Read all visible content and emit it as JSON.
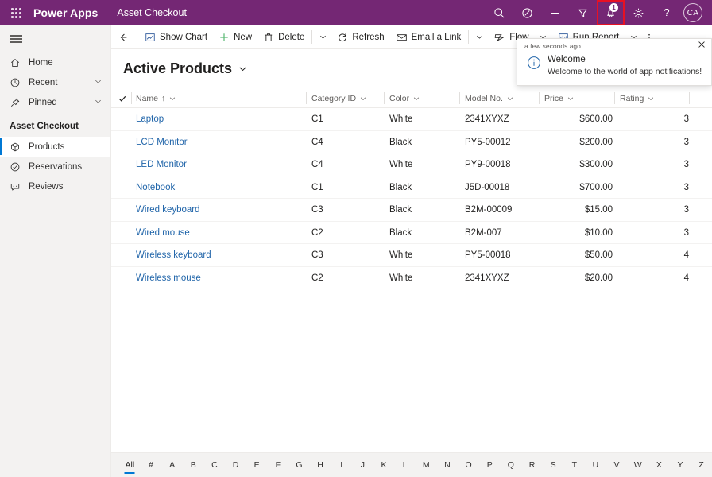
{
  "topbar": {
    "waffle_label": "app-launcher",
    "brand": "Power Apps",
    "app_name": "Asset Checkout",
    "icons": [
      "search-icon",
      "diagnostics-icon",
      "plus-icon",
      "filter-icon",
      "notification-bell-icon",
      "settings-gear-icon",
      "help-icon"
    ],
    "notification_count": "1",
    "avatar_initials": "CA",
    "background_color": "#742774",
    "highlight_color": "#e81123"
  },
  "sidebar": {
    "items": [
      {
        "label": "Home",
        "icon": "home-icon",
        "chevron": false
      },
      {
        "label": "Recent",
        "icon": "clock-icon",
        "chevron": true
      },
      {
        "label": "Pinned",
        "icon": "pin-icon",
        "chevron": true
      }
    ],
    "group_title": "Asset Checkout",
    "group_items": [
      {
        "label": "Products",
        "icon": "box-icon",
        "selected": true
      },
      {
        "label": "Reservations",
        "icon": "check-circle-icon",
        "selected": false
      },
      {
        "label": "Reviews",
        "icon": "comment-icon",
        "selected": false
      }
    ],
    "selected_accent": "#0078d4"
  },
  "commandbar": {
    "back_label": "back-arrow",
    "buttons": [
      {
        "label": "Show Chart",
        "icon": "chart-icon"
      },
      {
        "label": "New",
        "icon": "plus-icon"
      },
      {
        "label": "Delete",
        "icon": "trash-icon"
      },
      {
        "label": "Refresh",
        "icon": "refresh-icon"
      },
      {
        "label": "Email a Link",
        "icon": "email-icon"
      },
      {
        "label": "Flow",
        "icon": "flow-icon"
      },
      {
        "label": "Run Report",
        "icon": "report-icon"
      }
    ]
  },
  "notification": {
    "time": "a few seconds ago",
    "title": "Welcome",
    "message": "Welcome to the world of app notifications!",
    "close_label": "close",
    "icon": "info-circle-icon"
  },
  "view": {
    "title": "Active Products",
    "columns": [
      {
        "label": "Name",
        "sorted": true,
        "sort_arrow": "↑"
      },
      {
        "label": "Category ID",
        "sorted": false
      },
      {
        "label": "Color",
        "sorted": false
      },
      {
        "label": "Model No.",
        "sorted": false
      },
      {
        "label": "Price",
        "sorted": false
      },
      {
        "label": "Rating",
        "sorted": false
      }
    ],
    "rows": [
      {
        "name": "Laptop",
        "category": "C1",
        "color": "White",
        "model": "2341XYXZ",
        "price": "$600.00",
        "rating": "3"
      },
      {
        "name": "LCD Monitor",
        "category": "C4",
        "color": "Black",
        "model": "PY5-00012",
        "price": "$200.00",
        "rating": "3"
      },
      {
        "name": "LED Monitor",
        "category": "C4",
        "color": "White",
        "model": "PY9-00018",
        "price": "$300.00",
        "rating": "3"
      },
      {
        "name": "Notebook",
        "category": "C1",
        "color": "Black",
        "model": "J5D-00018",
        "price": "$700.00",
        "rating": "3"
      },
      {
        "name": "Wired keyboard",
        "category": "C3",
        "color": "Black",
        "model": "B2M-00009",
        "price": "$15.00",
        "rating": "3"
      },
      {
        "name": "Wired mouse",
        "category": "C2",
        "color": "Black",
        "model": "B2M-007",
        "price": "$10.00",
        "rating": "3"
      },
      {
        "name": "Wireless keyboard",
        "category": "C3",
        "color": "White",
        "model": "PY5-00018",
        "price": "$50.00",
        "rating": "4"
      },
      {
        "name": "Wireless mouse",
        "category": "C2",
        "color": "White",
        "model": "2341XYXZ",
        "price": "$20.00",
        "rating": "4"
      }
    ],
    "link_color": "#2266aa"
  },
  "alphabar": {
    "active": "All",
    "letters": [
      "All",
      "#",
      "A",
      "B",
      "C",
      "D",
      "E",
      "F",
      "G",
      "H",
      "I",
      "J",
      "K",
      "L",
      "M",
      "N",
      "O",
      "P",
      "Q",
      "R",
      "S",
      "T",
      "U",
      "V",
      "W",
      "X",
      "Y",
      "Z"
    ]
  }
}
